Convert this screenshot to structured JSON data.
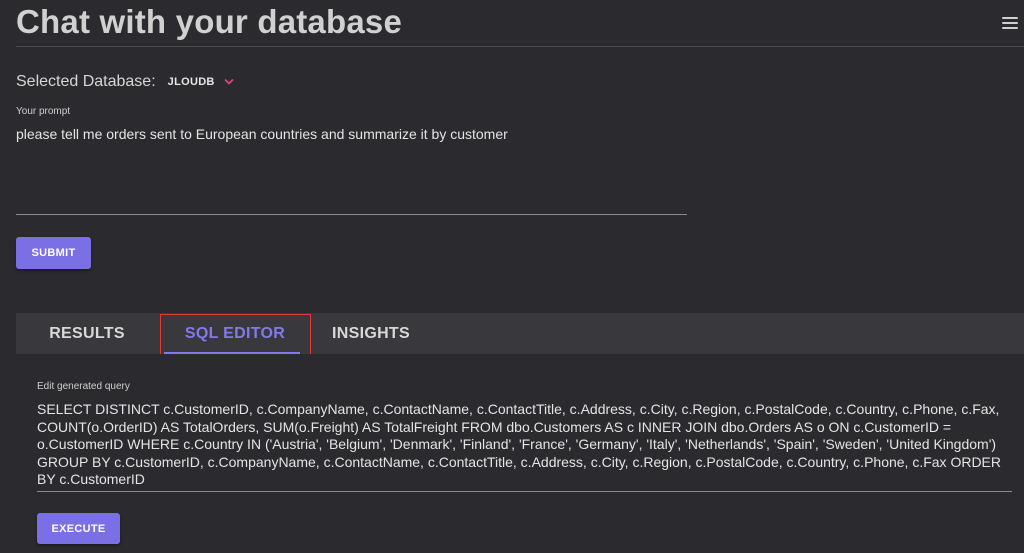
{
  "header": {
    "title": "Chat with your database",
    "menu_icon": "hamburger-menu-icon"
  },
  "database": {
    "label": "Selected Database:",
    "value": "JLOUDB",
    "accent_color": "#e8457a"
  },
  "prompt": {
    "label": "Your prompt",
    "value": "please tell me orders sent to European countries and summarize it by customer"
  },
  "actions": {
    "submit_label": "SUBMIT",
    "execute_label": "EXECUTE",
    "button_color": "#7b6fe6"
  },
  "tabs": [
    {
      "label": "RESULTS",
      "active": false
    },
    {
      "label": "SQL EDITOR",
      "active": true
    },
    {
      "label": "INSIGHTS",
      "active": false
    }
  ],
  "sql_editor": {
    "label": "Edit generated query",
    "query": "SELECT DISTINCT c.CustomerID, c.CompanyName, c.ContactName, c.ContactTitle, c.Address, c.City, c.Region, c.PostalCode, c.Country, c.Phone, c.Fax, COUNT(o.OrderID) AS TotalOrders, SUM(o.Freight) AS TotalFreight FROM dbo.Customers AS c INNER JOIN dbo.Orders AS o ON c.CustomerID = o.CustomerID WHERE c.Country IN ('Austria', 'Belgium', 'Denmark', 'Finland', 'France', 'Germany', 'Italy', 'Netherlands', 'Spain', 'Sweden', 'United Kingdom') GROUP BY c.CustomerID, c.CompanyName, c.ContactName, c.ContactTitle, c.Address, c.City, c.Region, c.PostalCode, c.Country, c.Phone, c.Fax ORDER BY c.CustomerID"
  },
  "colors": {
    "active_tab": "#8479ea",
    "highlight_box": "#e53935"
  }
}
